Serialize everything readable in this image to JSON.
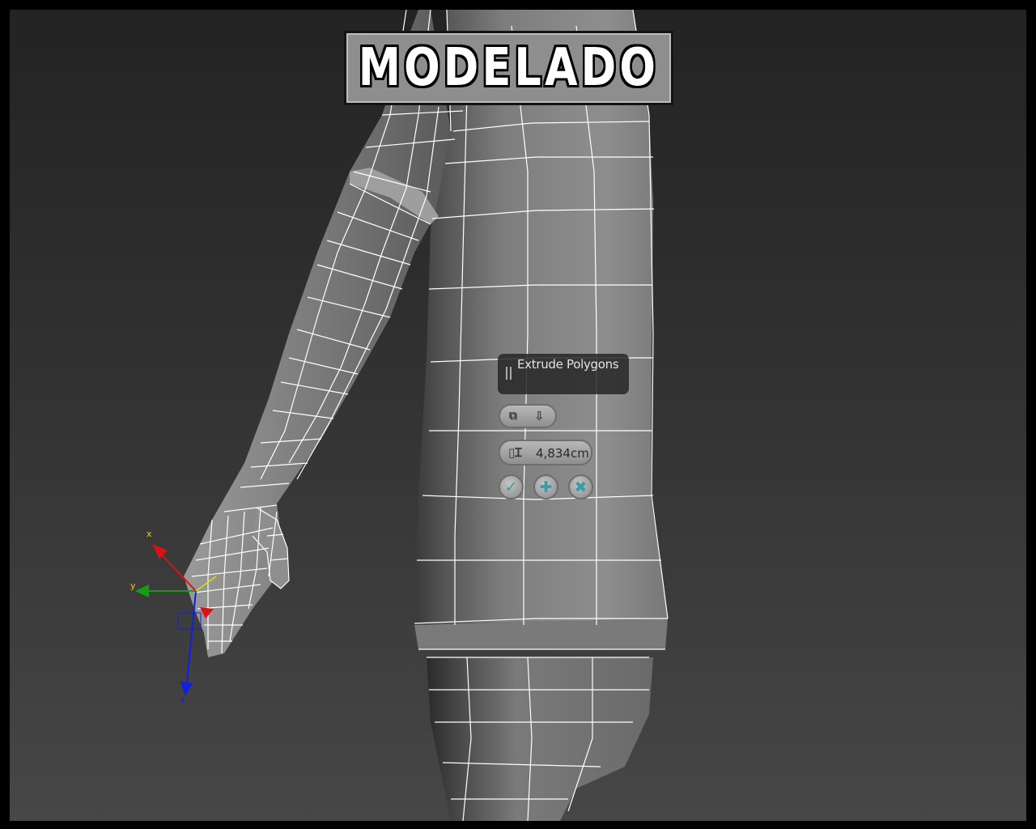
{
  "title": "MODELADO",
  "caddy": {
    "title": "Extrude Polygons",
    "height_value": "4,834cm",
    "buttons": [
      {
        "name": "ok",
        "icon": "check-icon"
      },
      {
        "name": "apply-and-continue",
        "icon": "plus-icon"
      },
      {
        "name": "cancel",
        "icon": "x-icon"
      }
    ],
    "group_icons": [
      "extrusion-type-icon",
      "dropdown-arrow-icon"
    ]
  },
  "gizmo": {
    "x_label": "x",
    "y_label": "y",
    "z_label": "z",
    "colors": {
      "x": "#e01010",
      "y": "#10a010",
      "z": "#1020e0"
    }
  },
  "colors": {
    "viewport_top": "#232323",
    "viewport_bottom": "#474747",
    "mesh_fill": "#8a8a8a",
    "wire": "#ffffff"
  }
}
